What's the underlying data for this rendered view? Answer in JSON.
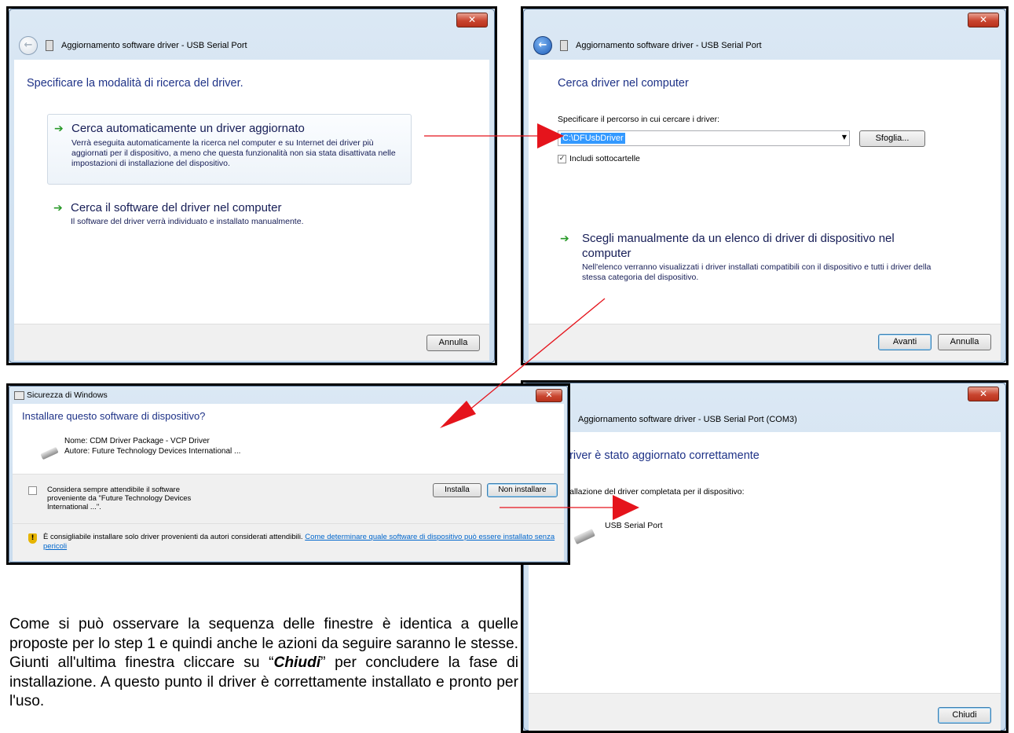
{
  "window1": {
    "nav_title": "Aggiornamento software driver - USB Serial Port",
    "heading": "Specificare la modalità di ricerca del driver.",
    "option1_title": "Cerca automaticamente un driver aggiornato",
    "option1_desc": "Verrà eseguita automaticamente la ricerca nel computer e su Internet dei driver più aggiornati per il dispositivo, a meno che questa funzionalità non sia stata disattivata nelle impostazioni di installazione del dispositivo.",
    "option2_title": "Cerca il software del driver nel computer",
    "option2_desc": "Il software del driver verrà individuato e installato manualmente.",
    "cancel_label": "Annulla"
  },
  "window2": {
    "nav_title": "Aggiornamento software driver - USB Serial Port",
    "heading": "Cerca driver nel computer",
    "path_label": "Specificare il percorso in cui cercare i driver:",
    "path_value": "C:\\DFUsbDriver",
    "browse_label": "Sfoglia...",
    "subfolders_label": "Includi sottocartelle",
    "subfolders_checked": true,
    "option_title": "Scegli manualmente da un elenco di driver di dispositivo nel computer",
    "option_desc": "Nell'elenco verranno visualizzati i driver installati compatibili con il dispositivo e tutti i driver della stessa categoria del dispositivo.",
    "next_label": "Avanti",
    "cancel_label": "Annulla"
  },
  "window3": {
    "title": "Sicurezza di Windows",
    "heading": "Installare questo software di dispositivo?",
    "name_line": "Nome: CDM Driver Package - VCP Driver",
    "author_line": "Autore: Future Technology Devices International ...",
    "trust_label": "Considera sempre attendibile il software proveniente da \"Future Technology Devices International ...\".",
    "trust_checked": false,
    "install_label": "Installa",
    "dont_install_label": "Non installare",
    "warning_text": "È consigliabile installare solo driver provenienti da autori considerati attendibili.",
    "warning_link": "Come determinare quale software di dispositivo può essere installato senza pericoli"
  },
  "window4": {
    "nav_title": "Aggiornamento software driver - USB Serial Port (COM3)",
    "heading": "driver è stato aggiornato correttamente",
    "completed_label": "stallazione del driver completata per il dispositivo:",
    "device_name": "USB Serial Port",
    "close_label": "Chiudi"
  },
  "paragraph": {
    "part1": "Come si può osservare la sequenza delle finestre è identica a quelle proposte per lo step 1 e quindi anche le azioni da seguire saranno le stesse. Giunti all'ultima finestra cliccare su “",
    "emphasis": "Chiudi",
    "part2": "” per concludere la fase di installazione. A questo punto il driver è correttamente installato e pronto per l'uso."
  },
  "colors": {
    "arrow": "#e5141c",
    "heading_blue": "#1e3287",
    "link_blue": "#0066cc",
    "close_red": "#c9452f"
  },
  "icons": [
    "back-arrow-icon",
    "usb-device-icon",
    "green-arrow-icon",
    "close-icon",
    "shield-warning-icon",
    "dropdown-icon",
    "red-arrow-icon"
  ]
}
